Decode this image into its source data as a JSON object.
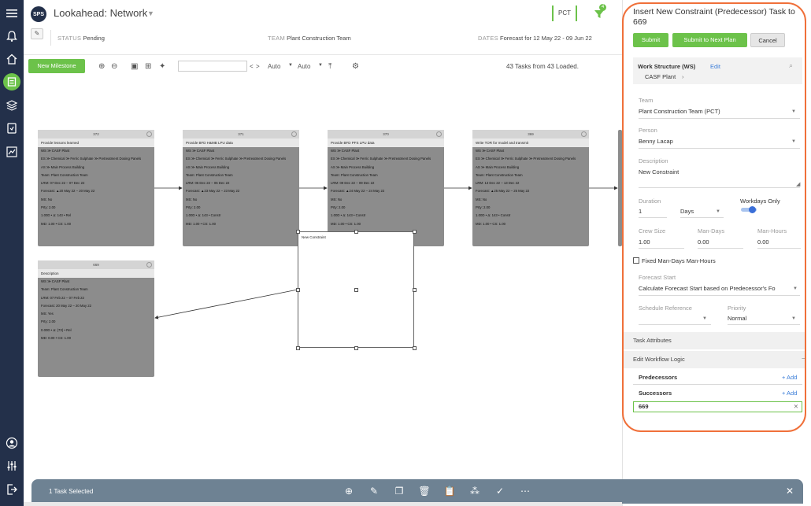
{
  "header": {
    "logo": "SPS",
    "title": "Lookahead: Network",
    "team_code": "PCT",
    "filter_badge": "4",
    "status_key": "STATUS",
    "status_value": "Pending",
    "team_key": "TEAM",
    "team_value": "Plant Construction Team",
    "dates_key": "DATES",
    "dates_value": "Forecast for 12 May 22 - 09 Jun 22"
  },
  "toolbar": {
    "new_milestone": "New Milestone",
    "nav_prev": "<",
    "nav_next": ">",
    "auto_1": "Auto",
    "auto_2": "Auto",
    "count": "43 Tasks from 43 Loaded."
  },
  "cards": [
    {
      "id": "372",
      "title": "Provide lessons learned",
      "lines": [
        "WS ≫ CASF Plant",
        "ES ≫ Chemical ≫ Ferric Sulphate ≫ Pretreatment Dosing Panels",
        "AS ≫ Main Process Building",
        "Team: Plant Construction Team",
        "LRM: 07 Dec 22 – 07 Dec 22",
        "Forecast: ▲20 May 22 – 20 May 22",
        "MS: No",
        "Prty: 2.00",
        "1.00D • Δ: 143 • Rel",
        "MD: 1.00 • CS: 1.00"
      ]
    },
    {
      "id": "371",
      "title": "Provide BFD H&MB LPU data",
      "lines": [
        "WS ≫ CASF Plant",
        "ES ≫ Chemical ≫ Ferric Sulphate ≫ Pretreatment Dosing Panels",
        "AS ≫ Main Process Building",
        "Team: Plant Construction Team",
        "LRM: 06 Dec 22 – 06 Dec 22",
        "Forecast: ▲23 May 22 – 23 May 22",
        "MS: No",
        "Prty: 2.00",
        "1.00D • Δ: 143 • Constr",
        "MD: 1.00 • CS: 1.00"
      ]
    },
    {
      "id": "370",
      "title": "Provide BFD PFS LPU data",
      "lines": [
        "WS ≫ CASF Plant",
        "ES ≫ Chemical ≫ Ferric Sulphate ≫ Pretreatment Dosing Panels",
        "AS ≫ Main Process Building",
        "Team: Plant Construction Team",
        "LRM: 09 Dec 22 – 09 Dec 22",
        "Forecast: ▲24 May 22 – 24 May 22",
        "MS: No",
        "Prty: 2.00",
        "1.00D • Δ: 143 • Constr",
        "MD: 1.00 • CS: 1.00"
      ]
    },
    {
      "id": "369",
      "title": "Write TOR for model and transmit",
      "lines": [
        "WS ≫ CASF Plant",
        "ES ≫ Chemical ≫ Ferric Sulphate ≫ Pretreatment Dosing Panels",
        "AS ≫ Main Process Building",
        "Team: Plant Construction Team",
        "LRM: 13 Dec 22 – 13 Dec 22",
        "Forecast: ▲25 May 22 – 25 May 22",
        "MS: No",
        "Prty: 2.00",
        "1.00D • Δ: 143 • Constr",
        "MD: 1.00 • CS: 1.00"
      ]
    },
    {
      "id": "669",
      "title": "Description",
      "lines": [
        "WS ≫ CASF Plant",
        "Team: Plant Construction Team",
        "LRM: 07 Feb 22 – 07 Feb 22",
        "Forecast: 20 May 22 – 20 May 22",
        "MS: Yes",
        "Prty: 2.00",
        "0.00D • Δ: (73) • Rel",
        "MD: 0.00 • CS: 1.00"
      ]
    }
  ],
  "new_constraint_label": "New Constraint",
  "panel": {
    "title": "Insert New Constraint (Predecessor) Task to 669",
    "submit": "Submit",
    "submit_next": "Submit to Next Plan",
    "cancel": "Cancel",
    "ws_label": "Work Structure (WS)",
    "ws_edit": "Edit",
    "ws_value": "CASF Plant",
    "team_label": "Team",
    "team_value": "Plant Construction Team (PCT)",
    "person_label": "Person",
    "person_value": "Benny Lacap",
    "desc_label": "Description",
    "desc_value": "New Constraint",
    "duration_label": "Duration",
    "duration_value": "1",
    "duration_unit": "Days",
    "workdays_label": "Workdays Only",
    "crew_label": "Crew Size",
    "crew_value": "1.00",
    "mandays_label": "Man-Days",
    "mandays_value": "0.00",
    "manhours_label": "Man-Hours",
    "manhours_value": "0.00",
    "fixed_label": "Fixed Man-Days Man-Hours",
    "forecast_label": "Forecast Start",
    "forecast_value": "Calculate Forecast Start based on Predecessor's Fo",
    "schedule_label": "Schedule Reference",
    "priority_label": "Priority",
    "priority_value": "Normal",
    "task_attributes": "Task Attributes",
    "workflow_logic": "Edit Workflow Logic",
    "predecessors": "Predecessors",
    "successors": "Successors",
    "add": "+ Add",
    "successor_value": "669"
  },
  "bottombar": {
    "selected": "1 Task Selected"
  }
}
